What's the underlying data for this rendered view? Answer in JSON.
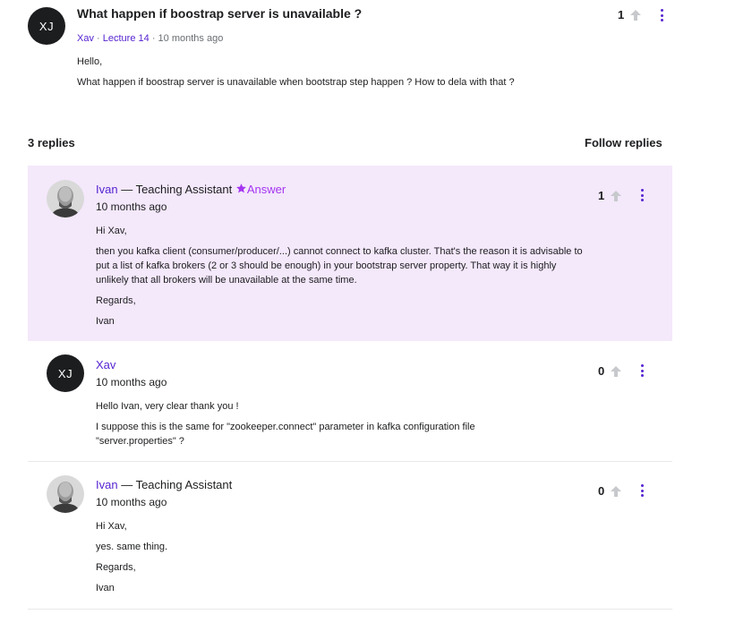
{
  "question": {
    "avatar_initials": "XJ",
    "title": "What happen if boostrap server is unavailable ?",
    "author": "Xav",
    "lecture": "Lecture 14",
    "time": "10 months ago",
    "body": [
      "Hello,",
      "What happen if boostrap server is unavailable when bootstrap step happen ? How to dela with that ?"
    ],
    "upvotes": "1"
  },
  "replies_header": {
    "count_label": "3 replies",
    "follow_label": "Follow replies"
  },
  "replies": [
    {
      "name": "Ivan",
      "role": "— Teaching Assistant",
      "badge": "Answer",
      "time": "10 months ago",
      "body": [
        "Hi Xav,",
        "then you kafka client (consumer/producer/...) cannot connect to kafka cluster. That's the reason it is advisable to put a list of kafka brokers (2 or 3 should be enough) in your bootstrap server property. That way it is highly unlikely that all brokers will be unavailable at the same time.",
        "Regards,",
        "Ivan"
      ],
      "upvotes": "1"
    },
    {
      "avatar_initials": "XJ",
      "name": "Xav",
      "time": "10 months ago",
      "body": [
        "Hello Ivan, very clear thank you !",
        "I suppose this is the same for \"zookeeper.connect\" parameter in kafka configuration file \"server.properties\" ?"
      ],
      "upvotes": "0"
    },
    {
      "name": "Ivan",
      "role": "— Teaching Assistant",
      "time": "10 months ago",
      "body": [
        "Hi Xav,",
        "yes. same thing.",
        "Regards,",
        "Ivan"
      ],
      "upvotes": "0"
    }
  ],
  "colors": {
    "accent": "#5624d0",
    "answer_bg": "#f4e8fb",
    "answer_badge": "#a435f0",
    "upvote_inactive": "#c7c9cc"
  },
  "icons": {
    "upvote": "arrow-up-icon",
    "more": "more-vertical-icon",
    "answer_badge": "star-icon"
  }
}
